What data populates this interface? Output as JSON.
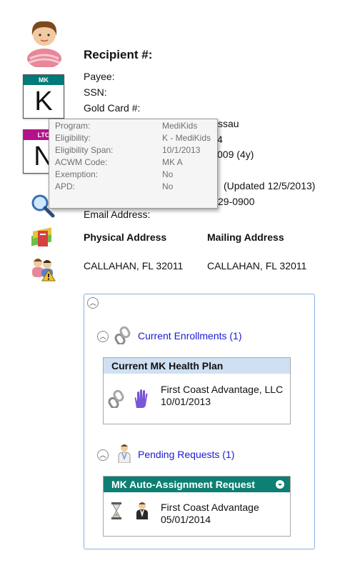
{
  "recipient": {
    "label": "Recipient #:",
    "payee_label": "Payee:",
    "ssn_label": "SSN:",
    "gold_card_label": "Gold Card #:",
    "partial_county": "ssau",
    "partial_digit": "4",
    "partial_dob": "009  (4y)",
    "partial_updated": "(Updated 12/5/2013)",
    "partial_phone": "29-0900",
    "email_label": "Email Address:",
    "physical_address_label": "Physical Address",
    "mailing_address_label": "Mailing Address",
    "physical_city": "CALLAHAN, FL  32011",
    "mailing_city": "CALLAHAN, FL  32011"
  },
  "badges": [
    {
      "code": "MK",
      "letter": "K",
      "color": "#007a7a"
    },
    {
      "code": "LTC",
      "letter": "N",
      "color": "#b5118c"
    }
  ],
  "tooltip": {
    "rows": [
      {
        "key": "Program:",
        "value": "MediKids"
      },
      {
        "key": "Eligibility:",
        "value": "K - MediKids"
      },
      {
        "key": "Eligibility Span:",
        "value": "10/1/2013"
      },
      {
        "key": "ACWM Code:",
        "value": "MK A"
      },
      {
        "key": "Exemption:",
        "value": "No"
      },
      {
        "key": "APD:",
        "value": "No"
      }
    ]
  },
  "panel": {
    "current_enrollments": {
      "link": "Current Enrollments (1)",
      "card_title": "Current MK Health Plan",
      "plan_name": "First Coast Advantage, LLC",
      "plan_date": "10/01/2013"
    },
    "pending_requests": {
      "link": "Pending Requests (1)",
      "card_title": "MK Auto-Assignment Request",
      "plan_name": "First Coast Advantage",
      "plan_date": "05/01/2014"
    }
  },
  "colors": {
    "mk_band": "#007a7a",
    "ltc_band": "#b5118c",
    "current_card_header": "#cfe0f3",
    "pending_card_header": "#0e7f73",
    "link": "#1a1ad8",
    "panel_border": "#8bb0e4"
  }
}
